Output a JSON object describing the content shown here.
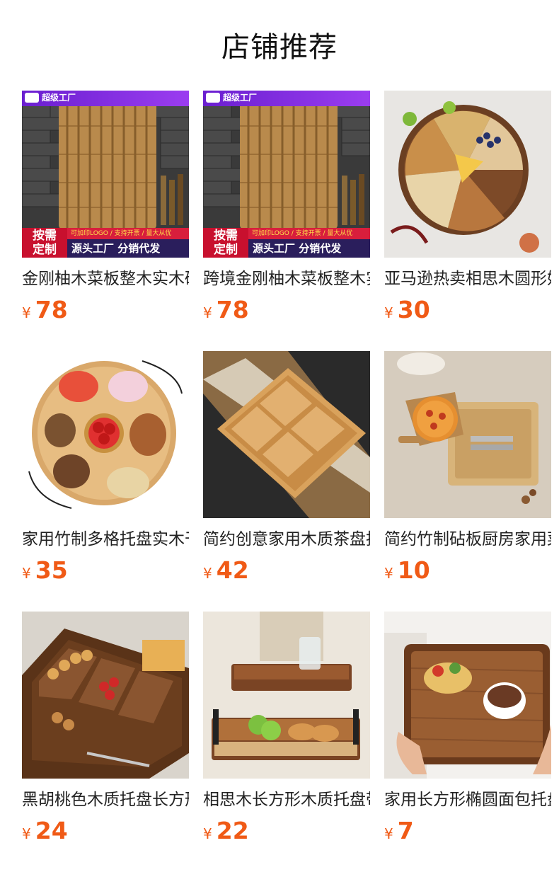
{
  "page": {
    "title": "店铺推荐"
  },
  "badge": {
    "brand": "超级工厂",
    "custom_label_line1": "按需",
    "custom_label_line2": "定制",
    "service_line": "可加印LOGO / 支持开票 / 量大从优",
    "source_line": "源头工厂 分销代发"
  },
  "currency_symbol": "¥",
  "products": [
    {
      "name": "金刚柚木菜板整木实木砧板",
      "price": "78",
      "image": "teak-end-grain-cutting-board"
    },
    {
      "name": "跨境金刚柚木菜板整木实木",
      "price": "78",
      "image": "teak-end-grain-cutting-board"
    },
    {
      "name": "亚马逊热卖相思木圆形奶酪",
      "price": "30",
      "image": "round-cheese-board"
    },
    {
      "name": "家用竹制多格托盘实木干果",
      "price": "35",
      "image": "bamboo-snack-tray"
    },
    {
      "name": "简约创意家用木质茶盘托盘",
      "price": "42",
      "image": "bamboo-four-grid-tray"
    },
    {
      "name": "简约竹制砧板厨房家用菜板",
      "price": "10",
      "image": "bamboo-cutting-board-pizza"
    },
    {
      "name": "黑胡桃色木质托盘长方形分",
      "price": "24",
      "image": "walnut-divided-tray"
    },
    {
      "name": "相思木长方形木质托盘带把",
      "price": "22",
      "image": "acacia-serving-tray"
    },
    {
      "name": "家用长方形椭圆面包托盘木",
      "price": "7",
      "image": "square-wooden-tray"
    }
  ]
}
